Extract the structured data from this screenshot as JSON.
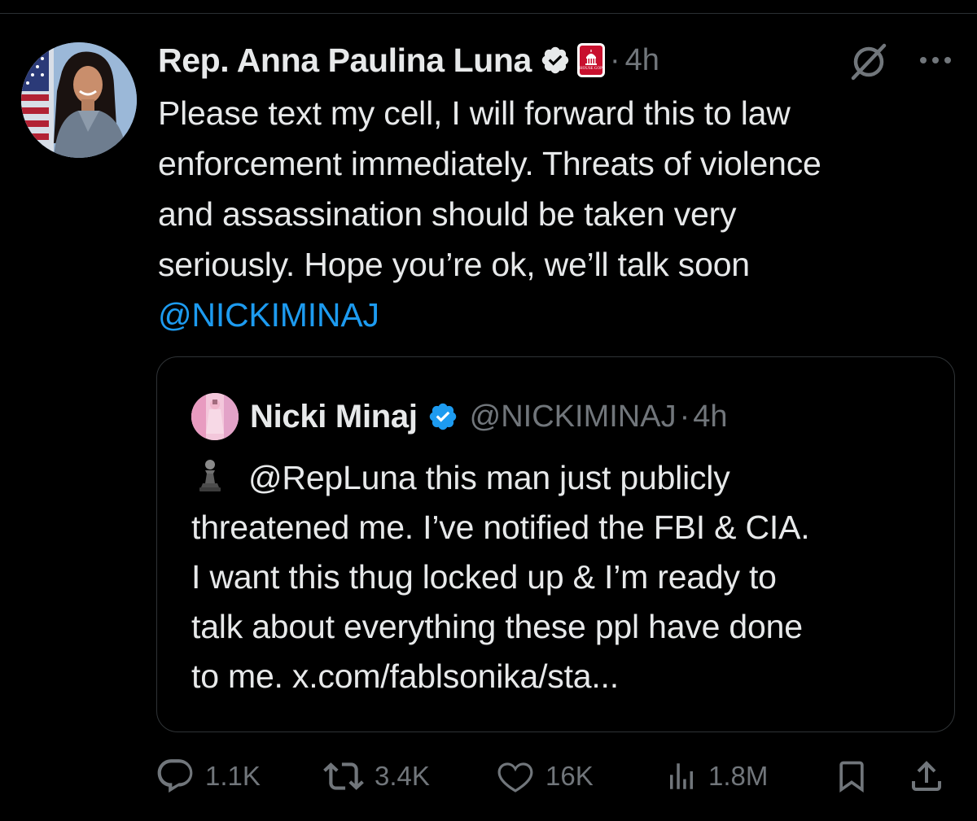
{
  "tweet": {
    "author_name": "Rep. Anna Paulina Luna",
    "verified_icon": "verified-badge-icon",
    "affiliate_badge": "house-gop-badge",
    "affiliate_badge_text": "HOUSE GOP",
    "separator": "·",
    "time": "4h",
    "text_lines": [
      "Please text my cell, I will forward this to law",
      "enforcement immediately. Threats of violence",
      "and assassination should be taken very",
      "seriously. Hope you’re ok, we’ll talk soon"
    ],
    "mention": "@NICKIMINAJ"
  },
  "quoted_tweet": {
    "author_name": "Nicki Minaj",
    "verified_icon": "verified-badge-icon",
    "handle": "@NICKIMINAJ",
    "separator": "·",
    "time": "4h",
    "emoji": "chess-pawn-icon",
    "text_lines": [
      "@RepLuna this man just publicly",
      "threatened me. I’ve notified the FBI & CIA.",
      "I want this thug locked up & I’m ready to",
      "talk about everything these ppl have done",
      "to me. x.com/fablsonika/sta..."
    ]
  },
  "actions": {
    "replies": "1.1K",
    "retweets": "3.4K",
    "likes": "16K",
    "views": "1.8M"
  },
  "colors": {
    "background": "#000000",
    "text": "#e7e9ea",
    "secondary": "#71767b",
    "link": "#1d9bf0",
    "border": "#2f3336",
    "verified": "#1d9bf0"
  }
}
